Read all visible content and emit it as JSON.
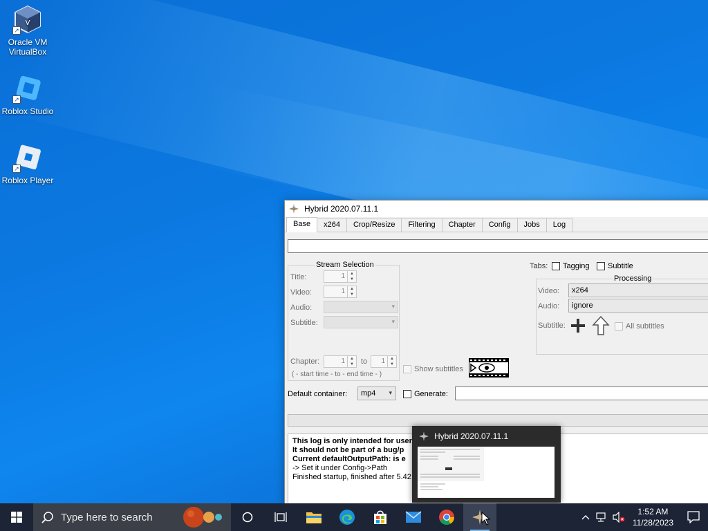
{
  "desktop": {
    "icons": [
      {
        "label": "Oracle VM VirtualBox"
      },
      {
        "label": "Roblox Studio"
      },
      {
        "label": "Roblox Player"
      }
    ]
  },
  "window": {
    "title": "Hybrid 2020.07.11.1",
    "tabs": [
      "Base",
      "x264",
      "Crop/Resize",
      "Filtering",
      "Chapter",
      "Config",
      "Jobs",
      "Log"
    ],
    "stream_selection": {
      "title": "Stream Selection",
      "title_label": "Title:",
      "title_value": "1",
      "video_label": "Video:",
      "video_value": "1",
      "audio_label": "Audio:",
      "subtitle_label": "Subtitle:",
      "chapter_label": "Chapter:",
      "chapter_from": "1",
      "to_label": "to",
      "chapter_to": "1",
      "time_hint": "( - start time -  to  - end time - )"
    },
    "tabs_options": {
      "label": "Tabs:",
      "tagging": "Tagging",
      "subtitle": "Subtitle"
    },
    "processing": {
      "title": "Processing",
      "video_label": "Video:",
      "video_value": "x264",
      "audio_label": "Audio:",
      "audio_value": "ignore",
      "subtitle_label": "Subtitle:",
      "all_subtitles": "All subtitles"
    },
    "show_subtitles": "Show subtitles",
    "default_container_label": "Default container:",
    "default_container_value": "mp4",
    "generate_label": "Generate:",
    "log": {
      "line1": "This log is only intended for user information.",
      "line2": "It should not be part of a bug/p",
      "line3": "Current defaultOutputPath: is e",
      "line4": " -> Set it under Config->Path",
      "line5": "Finished startup, finished after 5.42"
    }
  },
  "thumbnail": {
    "title": "Hybrid 2020.07.11.1"
  },
  "taskbar": {
    "search_placeholder": "Type here to search",
    "clock_time": "1:52 AM",
    "clock_date": "11/28/2023"
  },
  "colors": {
    "desktop_blue": "#0b78e0",
    "taskbar": "#1c2436",
    "search_box": "#3b3f48"
  }
}
